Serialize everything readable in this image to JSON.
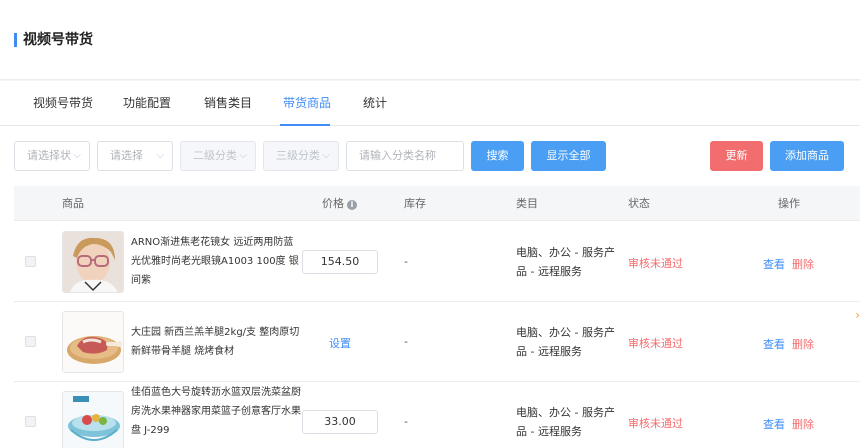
{
  "header": {
    "title": "视频号带货"
  },
  "tabs": [
    {
      "label": "视频号带货",
      "active": false
    },
    {
      "label": "功能配置",
      "active": false
    },
    {
      "label": "销售类目",
      "active": false
    },
    {
      "label": "带货商品",
      "active": true
    },
    {
      "label": "统计",
      "active": false
    }
  ],
  "filters": {
    "status_placeholder": "请选择状",
    "select_placeholder": "请选择",
    "level2_placeholder": "二级分类",
    "level3_placeholder": "三级分类",
    "name_placeholder": "请输入分类名称"
  },
  "buttons": {
    "search": "搜索",
    "show_all": "显示全部",
    "refresh": "更新",
    "add_product": "添加商品"
  },
  "table": {
    "columns": {
      "product": "商品",
      "price": "价格",
      "stock": "库存",
      "category": "类目",
      "status": "状态",
      "actions": "操作"
    },
    "rows": [
      {
        "name": "ARNO渐进焦老花镜女 远近两用防蓝光优雅时尚老光眼镜A1003 100度 银间紫",
        "price": "154.50",
        "stock": "-",
        "category": "电脑、办公 - 服务产品 - 远程服务",
        "status": "审核未通过",
        "view": "查看",
        "delete": "删除"
      },
      {
        "name": "大庄园 新西兰羔羊腿2kg/支 整肉原切 新鲜带骨羊腿 烧烤食材",
        "price_link": "设置",
        "stock": "-",
        "category": "电脑、办公 - 服务产品 - 远程服务",
        "status": "审核未通过",
        "view": "查看",
        "delete": "删除"
      },
      {
        "name": "佳佰蓝色大号旋转沥水篮双层洗菜盆厨房洗水果神器家用菜篮子创意客厅水果盘 J-299",
        "price": "33.00",
        "stock": "-",
        "category": "电脑、办公 - 服务产品 - 远程服务",
        "status": "审核未通过",
        "view": "查看",
        "delete": "删除"
      }
    ]
  },
  "icons": {
    "info": "info-circle-icon",
    "caret": "chevron-down-icon"
  },
  "colors": {
    "accent": "#3f8cf6",
    "danger": "#f56c6c",
    "button_blue": "#4a9ff5",
    "button_red": "#f26e6e"
  }
}
